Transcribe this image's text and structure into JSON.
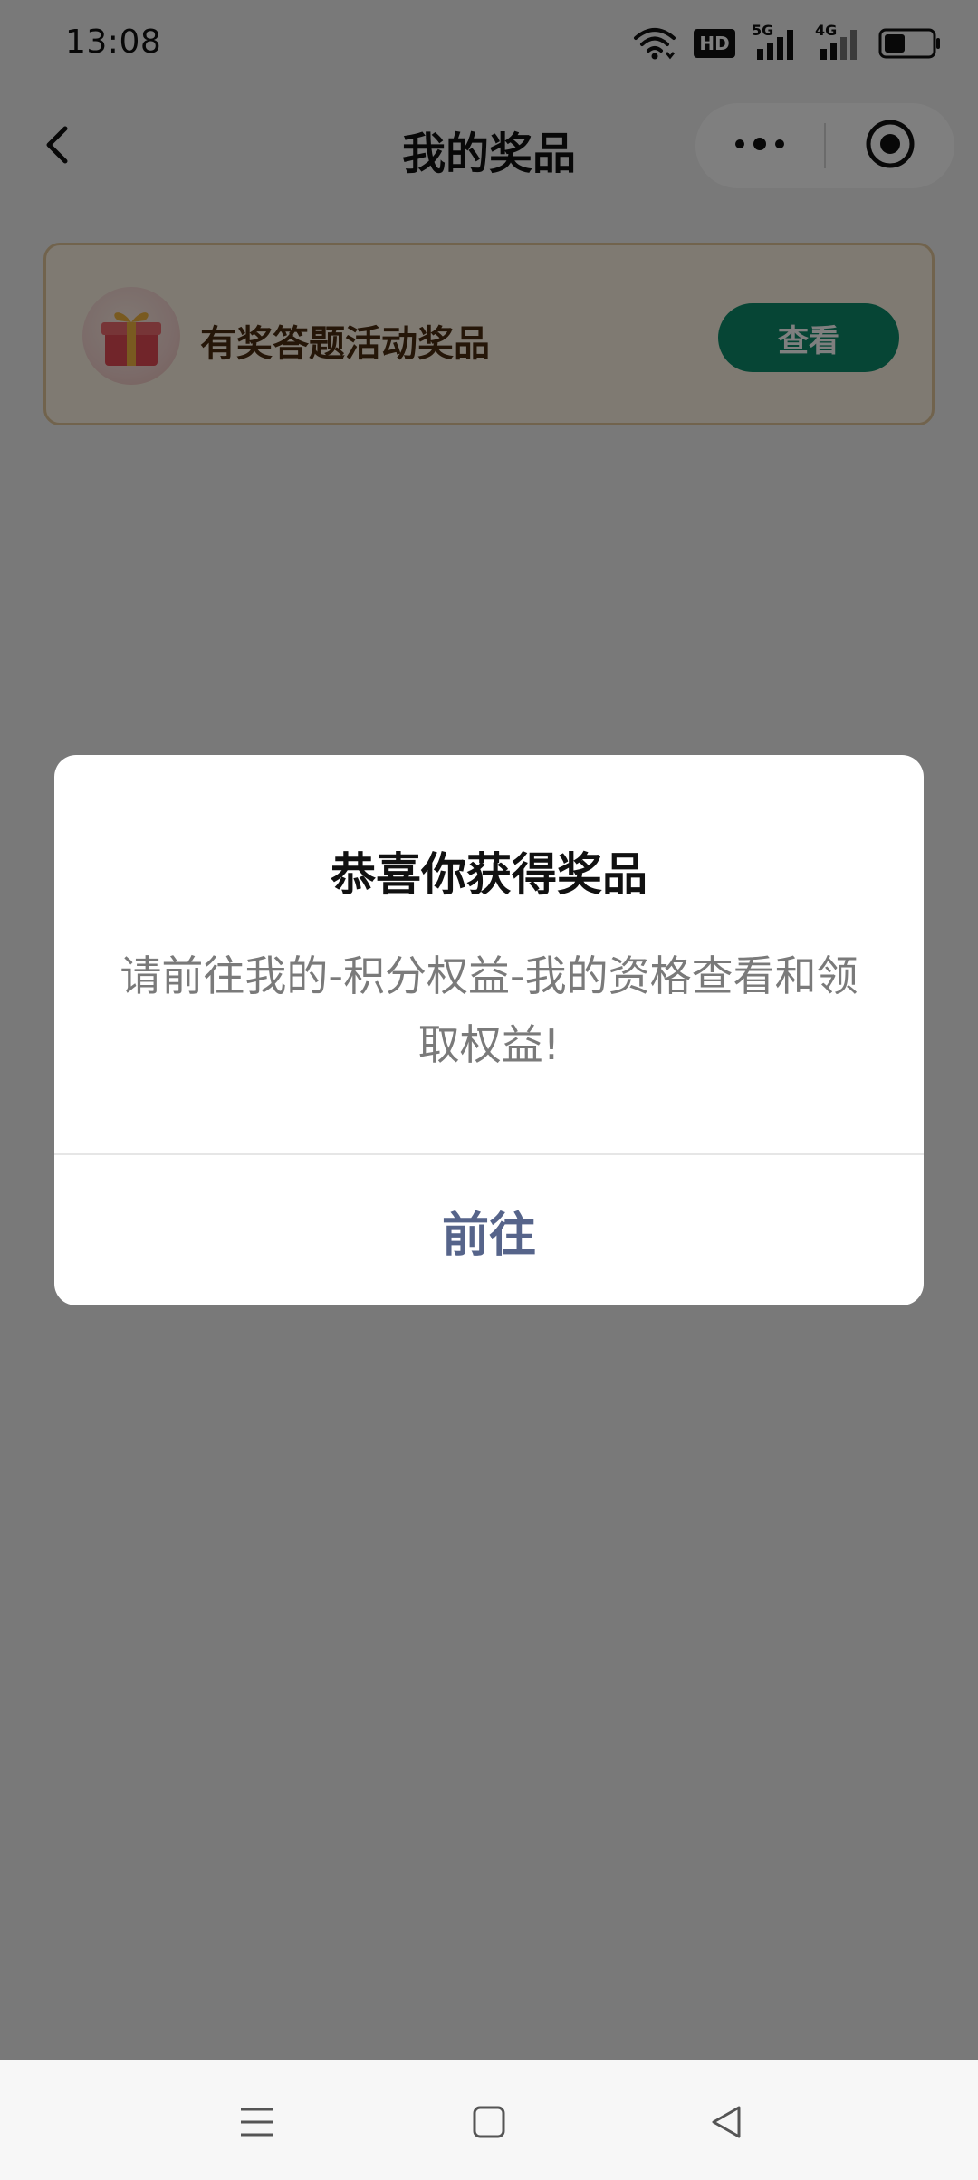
{
  "status_bar": {
    "time": "13:08",
    "hd_label": "HD",
    "sim1_label": "5G",
    "sim2_label": "4G",
    "icons": [
      "wifi-icon",
      "hd-icon",
      "signal-5g-icon",
      "signal-4g-icon",
      "battery-icon"
    ]
  },
  "nav": {
    "title": "我的奖品",
    "icons": [
      "back-icon",
      "more-icon",
      "target-icon"
    ]
  },
  "prize_card": {
    "title": "有奖答题活动奖品",
    "button_label": "查看",
    "icon": "gift-icon",
    "button_color": "#0c8b6a"
  },
  "dialog": {
    "title": "恭喜你获得奖品",
    "message": "请前往我的-积分权益-我的资格查看和领取权益!",
    "action_label": "前往",
    "action_color": "#56648a"
  },
  "system_nav": {
    "icons": [
      "menu-lines-icon",
      "home-square-icon",
      "back-triangle-icon"
    ]
  }
}
